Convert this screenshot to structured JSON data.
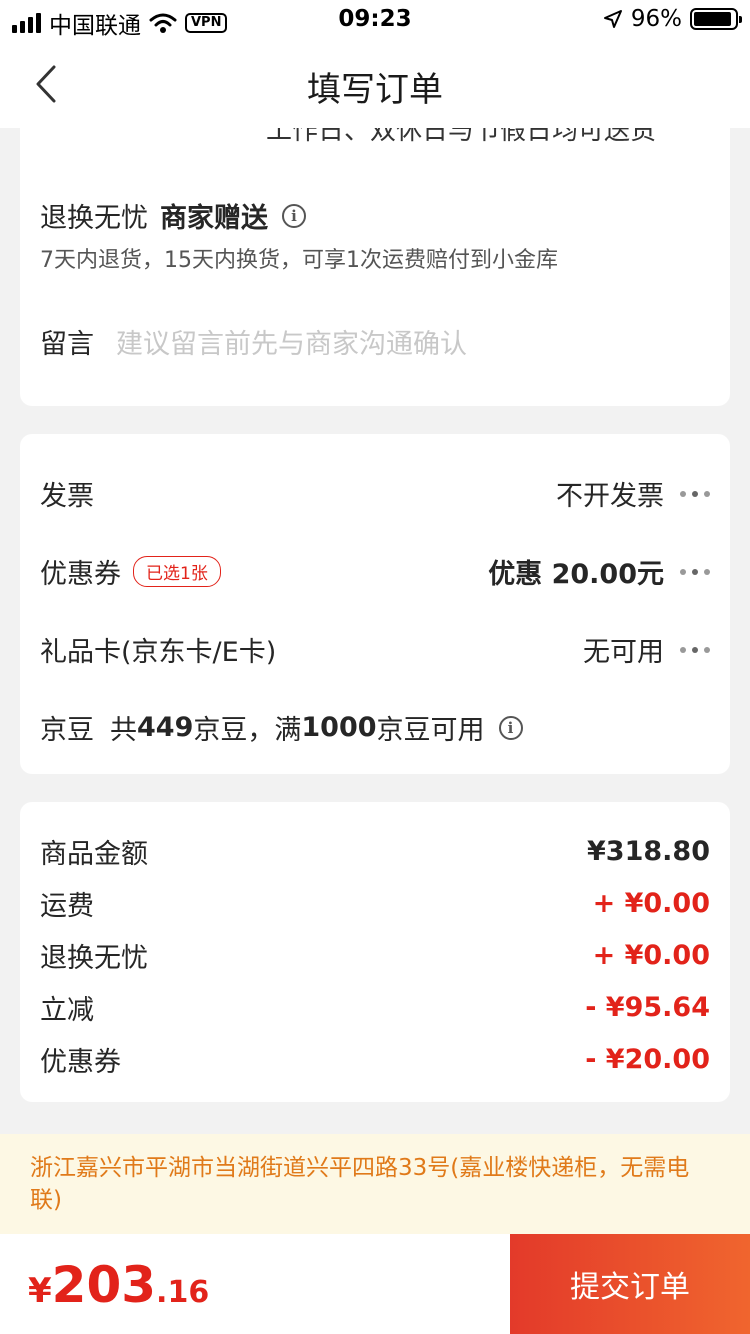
{
  "status_bar": {
    "carrier": "中国联通",
    "vpn": "VPN",
    "time": "09:23",
    "battery": "96%"
  },
  "nav": {
    "title": "填写订单"
  },
  "delivery": {
    "clipped_text": "工作日、双休日与节假日均可送货"
  },
  "return_service": {
    "label": "退换无忧",
    "highlight": "商家赠送",
    "description": "7天内退货，15天内换货，可享1次运费赔付到小金库"
  },
  "message": {
    "label": "留言",
    "placeholder": "建议留言前先与商家沟通确认"
  },
  "invoice": {
    "label": "发票",
    "value": "不开发票"
  },
  "coupon": {
    "label": "优惠券",
    "chip": "已选1张",
    "value": "优惠 20.00元"
  },
  "gift_card": {
    "label": "礼品卡(京东卡/E卡)",
    "value": "无可用"
  },
  "jingdou": {
    "label": "京豆",
    "text_prefix": "共",
    "count": "449",
    "text_mid": "京豆，满",
    "threshold": "1000",
    "text_suffix": "京豆可用"
  },
  "summary": [
    {
      "label": "商品金额",
      "amount": "¥318.80",
      "color": "#262626"
    },
    {
      "label": "运费",
      "amount": "+ ¥0.00",
      "color": "#e2231a"
    },
    {
      "label": "退换无忧",
      "amount": "+ ¥0.00",
      "color": "#e2231a"
    },
    {
      "label": "立减",
      "amount": "- ¥95.64",
      "color": "#e2231a"
    },
    {
      "label": "优惠券",
      "amount": "- ¥20.00",
      "color": "#e2231a"
    }
  ],
  "address": {
    "text": "浙江嘉兴市平湖市当湖街道兴平四路33号(嘉业楼快递柜，无需电联)"
  },
  "bottom": {
    "currency": "¥",
    "total_int": "203",
    "total_dec": ".16",
    "submit_label": "提交订单"
  },
  "colors": {
    "accent_red": "#e2231a",
    "address_text": "#e07a1a",
    "address_bg": "#fdf8e4"
  }
}
